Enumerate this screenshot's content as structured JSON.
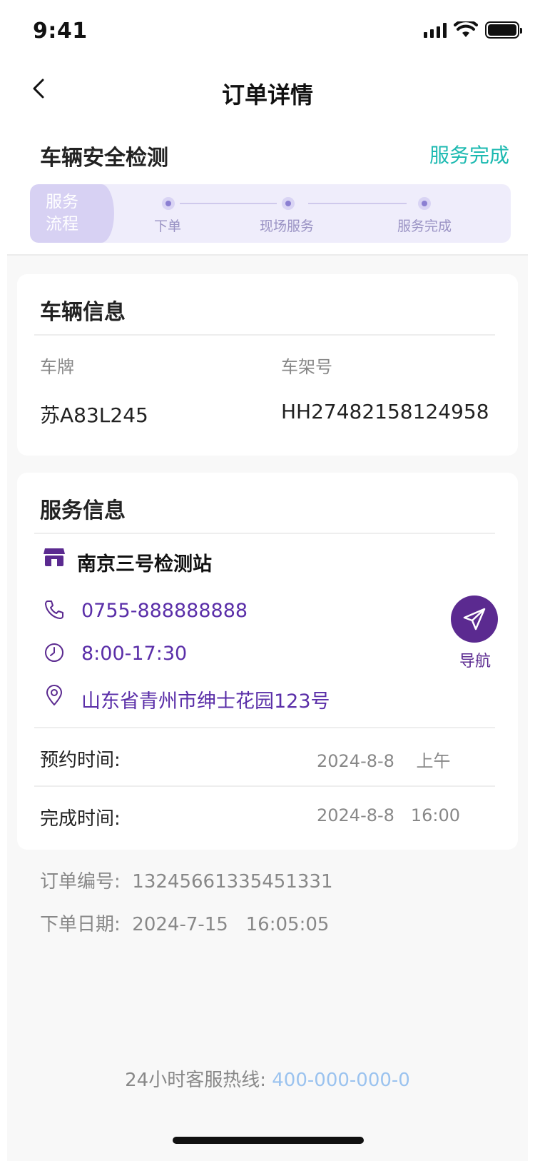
{
  "status_bar": {
    "time": "9:41"
  },
  "nav": {
    "title": "订单详情"
  },
  "service": {
    "name": "车辆安全检测",
    "status": "服务完成"
  },
  "flow": {
    "tag": "服务流程",
    "steps": [
      "下单",
      "现场服务",
      "服务完成"
    ]
  },
  "vehicle_card": {
    "title": "车辆信息",
    "plate_label": "车牌",
    "plate_value": "苏A83L245",
    "vin_label": "车架号",
    "vin_value": "HH27482158124958"
  },
  "service_card": {
    "title": "服务信息",
    "shop_name": "南京三号检测站",
    "phone": "0755-888888888",
    "hours": "8:00-17:30",
    "address": "山东省青州市绅士花园123号",
    "navigate_label": "导航",
    "booking_label": "预约时间:",
    "booking_value": "2024-8-8    上午",
    "finish_label": "完成时间:",
    "finish_value": "2024-8-8   16:00"
  },
  "order": {
    "number": "订单编号:  13245661335451331",
    "date": "下单日期:  2024-7-15   16:05:05"
  },
  "hotline": {
    "label": "24小时客服热线:",
    "number": "400-000-000-0"
  },
  "colors": {
    "accent": "#5b2a90",
    "status_done": "#1bb9b0",
    "hotline": "#9bc3ef"
  },
  "icons": [
    "back-icon",
    "shop-icon",
    "phone-icon",
    "clock-icon",
    "location-icon",
    "send-icon"
  ]
}
